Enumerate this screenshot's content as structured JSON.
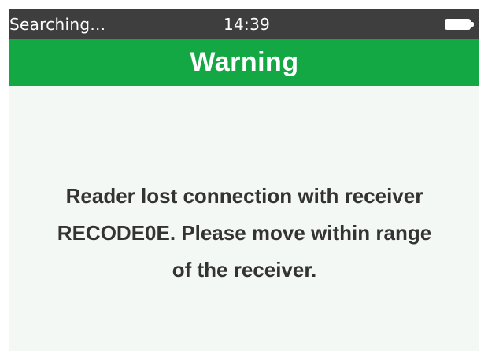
{
  "status_bar": {
    "status_text": "Searching...",
    "time": "14:39",
    "battery_icon": "battery-full-icon"
  },
  "title_bar": {
    "title": "Warning"
  },
  "message": {
    "lines": [
      "Reader lost connection with receiver",
      "RECODE0E.  Please move within range",
      "of the receiver."
    ]
  },
  "colors": {
    "status_bar_bg": "#3e3e3e",
    "title_bar_bg": "#14a844",
    "screen_bg": "#f4f8f5",
    "message_text": "#333333"
  }
}
